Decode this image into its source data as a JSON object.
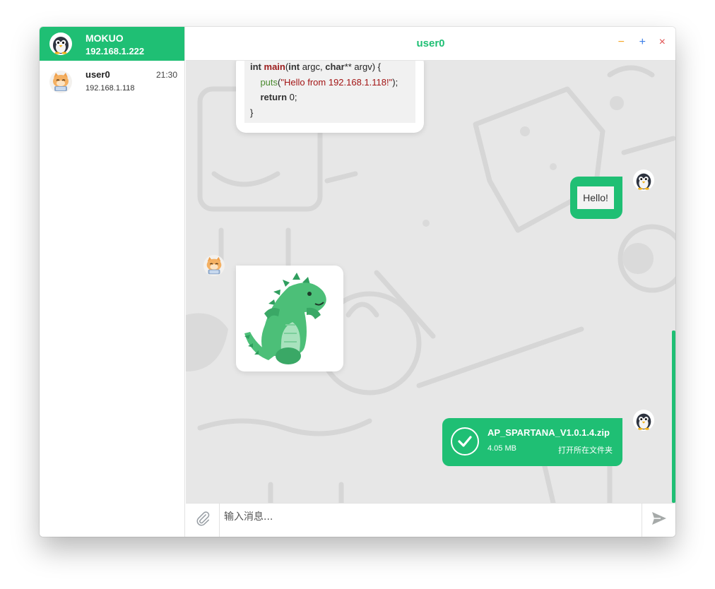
{
  "me": {
    "name": "MOKUO",
    "ip": "192.168.1.222",
    "avatar_icon": "penguin-avatar-icon"
  },
  "contacts": [
    {
      "name": "user0",
      "ip": "192.168.1.118",
      "time": "21:30",
      "avatar_icon": "cat-avatar-icon"
    }
  ],
  "header": {
    "title": "user0",
    "minimize_label": "−",
    "maximize_label": "+",
    "close_label": "×"
  },
  "messages": {
    "code": {
      "line1": {
        "type": "int",
        "fn": "main",
        "open": "(",
        "type2": "int",
        "arg1": " argc, ",
        "type3": "char",
        "arg2": "** argv) {"
      },
      "line2": {
        "call": "puts",
        "open": "(",
        "str": "\"Hello from 192.168.1.118!\"",
        "close": ");"
      },
      "line3": {
        "kw": "return",
        "rest": " 0;"
      },
      "line4": "}"
    },
    "hello": "Hello!",
    "sticker_icon": "dinosaur-sticker-icon",
    "file": {
      "name": "AP_SPARTANA_V1.0.1.4.zip",
      "size": "4.05 MB",
      "open_label": "打开所在文件夹"
    }
  },
  "input": {
    "placeholder": "输入消息..."
  },
  "colors": {
    "accent": "#1fbf74",
    "chat_bg": "#e7e7e7",
    "minimize": "#f5a623",
    "maximize": "#3b7de8",
    "close": "#e05050"
  }
}
